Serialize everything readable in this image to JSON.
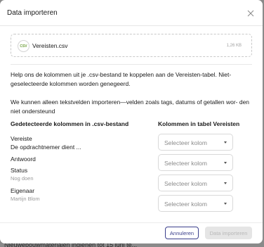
{
  "backdrop": {
    "text": "Nieuwebouwmaterialen indienen tot 15 juni te..."
  },
  "modal": {
    "title": "Data importeren",
    "file": {
      "icon_label": "CSV",
      "name": "Vereisten.csv",
      "size": "1,26 KB"
    },
    "help_text": "Help ons de kolommen uit je .csv-bestand te koppelen aan de Vereisten-tabel. Niet-geselecteerde kolommen worden genegeerd.",
    "warning_text": "We kunnen alleen tekstvelden importeren—velden zoals tags, datums of getallen wor- den niet ondersteund",
    "columns": {
      "left_header": "Gedetecteerde kolommen in .csv-bestand",
      "right_header": "Kolommen in tabel Vereisten"
    },
    "rows": [
      {
        "label": "Vereiste",
        "sample": "De opdrachtnemer dient ...",
        "select_placeholder": "Selecteer kolom"
      },
      {
        "label": "Antwoord",
        "sample": "",
        "select_placeholder": "Selecteer kolom"
      },
      {
        "label": "Status",
        "sample": "Nog doen",
        "select_placeholder": "Selecteer kolom"
      },
      {
        "label": "Eigenaar",
        "sample": "Martijn Blom",
        "select_placeholder": "Selecteer kolom"
      }
    ],
    "buttons": {
      "cancel": "Annuleren",
      "import": "Data importeren"
    }
  },
  "colors": {
    "accent": "#3b3f8c",
    "csv_icon": "#6e9e3a",
    "disabled_bg": "#e5e5e5"
  },
  "icons": {
    "close": "close-icon",
    "file": "csv-file-icon",
    "caret": "chevron-down-icon"
  }
}
